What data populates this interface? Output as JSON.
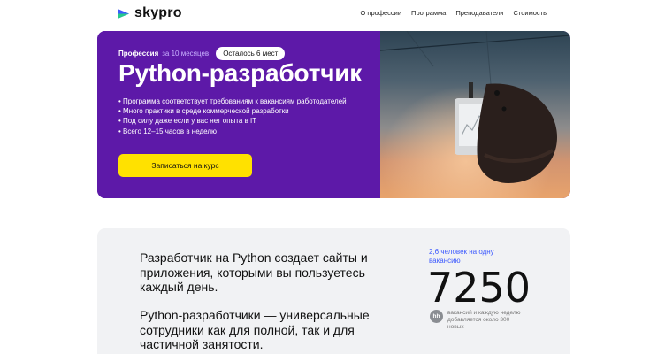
{
  "header": {
    "logo_text": "skypro",
    "nav": [
      "О профессии",
      "Программа",
      "Преподаватели",
      "Стоимость"
    ]
  },
  "hero": {
    "profession_label": "Профессия",
    "duration": "за 10 месяцев",
    "seats_left": "Осталось 6 мест",
    "title": "Python-разработчик",
    "bullets": [
      "• Программа соответствует требованиям к вакансиям работодателей",
      "• Много практики в среде коммерческой разработки",
      "• Под силу даже если у вас нет опыта в IT",
      "• Всего 12–15 часов в неделю"
    ],
    "cta_label": "Записаться на курс"
  },
  "info": {
    "paragraph1": "Разработчик на Python создает сайты и приложения, которыми вы пользуетесь каждый день.",
    "paragraph2": "Python-разработчики — универсальные сотрудники как для полной, так и для частичной занятости.",
    "stat_note": "2,6 человек на одну вакансию",
    "stat_number": "7250",
    "hh_badge": "hh",
    "stat_caption": "вакансий и каждую неделю добавляется около 300 новых"
  },
  "colors": {
    "accent_purple": "#5d19a8",
    "cta_yellow": "#ffe100",
    "link_blue": "#3d5afe",
    "logo_blue": "#3d5afe",
    "logo_green": "#27c98a"
  }
}
